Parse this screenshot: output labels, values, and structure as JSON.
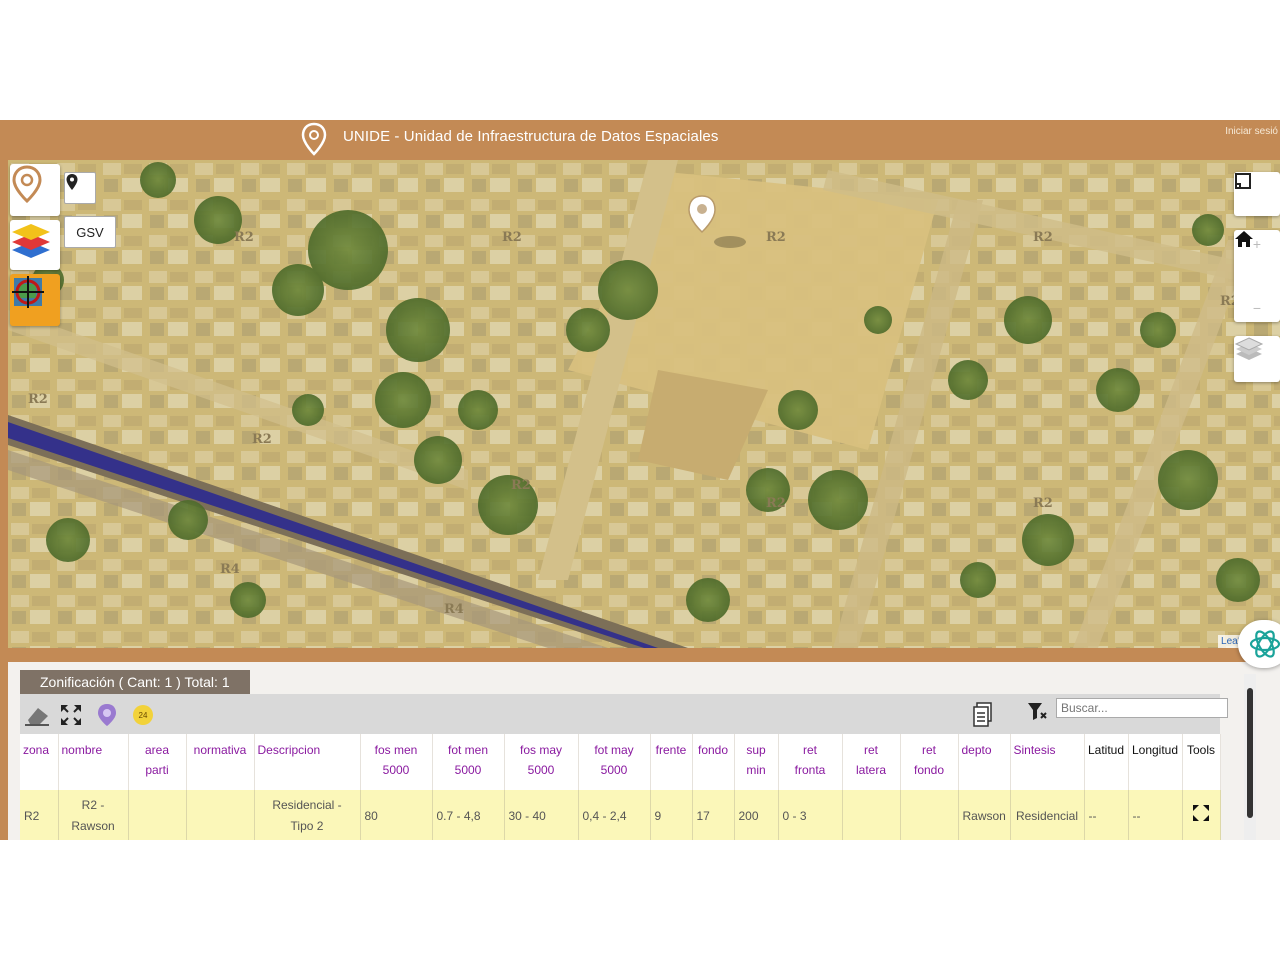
{
  "header": {
    "title": "UNIDE - Unidad de Infraestructura de Datos Espaciales",
    "login": "Iniciar sesió"
  },
  "map": {
    "gsv_label": "GSV",
    "zone_labels": [
      "R2",
      "R2",
      "R2",
      "R2",
      "R2",
      "R2",
      "R2",
      "R2",
      "R2",
      "R2",
      "R4",
      "R4"
    ],
    "attribution": "Leaflet | IGN"
  },
  "panel": {
    "tab_title": "Zonificación ( Cant: 1 ) Total: 1",
    "search_placeholder": "Buscar...",
    "count_badge": "24",
    "columns": [
      {
        "l1": "zona",
        "l2": ""
      },
      {
        "l1": "nombre",
        "l2": ""
      },
      {
        "l1": "area",
        "l2": "parti"
      },
      {
        "l1": "normativa",
        "l2": ""
      },
      {
        "l1": "Descripcion",
        "l2": ""
      },
      {
        "l1": "fos men",
        "l2": "5000"
      },
      {
        "l1": "fot men",
        "l2": "5000"
      },
      {
        "l1": "fos may",
        "l2": "5000"
      },
      {
        "l1": "fot may",
        "l2": "5000"
      },
      {
        "l1": "frente",
        "l2": ""
      },
      {
        "l1": "fondo",
        "l2": ""
      },
      {
        "l1": "sup",
        "l2": "min"
      },
      {
        "l1": "ret",
        "l2": "fronta"
      },
      {
        "l1": "ret",
        "l2": "latera"
      },
      {
        "l1": "ret",
        "l2": "fondo"
      },
      {
        "l1": "depto",
        "l2": ""
      },
      {
        "l1": "Sintesis",
        "l2": ""
      },
      {
        "l1": "Latitud",
        "l2": ""
      },
      {
        "l1": "Longitud",
        "l2": ""
      },
      {
        "l1": "Tools",
        "l2": ""
      }
    ],
    "row": {
      "zona": "R2",
      "nombre_l1": "R2 -",
      "nombre_l2": "Rawson",
      "area_parti": "",
      "normativa": "",
      "descripcion_l1": "Residencial -",
      "descripcion_l2": "Tipo 2",
      "fos_men": "80",
      "fot_men": "0.7 - 4,8",
      "fos_may": "30 - 40",
      "fot_may": "0,4 - 2,4",
      "frente": "9",
      "fondo": "17",
      "sup_min": "200",
      "ret_fronta": "0 - 3",
      "ret_latera": "",
      "ret_fondo": "",
      "depto": "Rawson",
      "sintesis": "Residencial",
      "latitud": "--",
      "longitud": "--"
    }
  },
  "colors": {
    "brand": "#c38a55",
    "tab": "#7f7266",
    "header_text": "#8a1aa0",
    "row_bg": "#fbf7b9",
    "road": "#34318a"
  },
  "icons": [
    "pin-logo-icon",
    "map-marker-icon",
    "layers-icon",
    "target-icon",
    "fullscreen-icon",
    "home-icon",
    "zoom-in-icon",
    "zoom-out-icon",
    "layers-switch-icon",
    "eraser-icon",
    "expand-icon",
    "pin-style-icon",
    "export-icon",
    "filter-icon",
    "expand-row-icon",
    "chatbot-icon"
  ]
}
